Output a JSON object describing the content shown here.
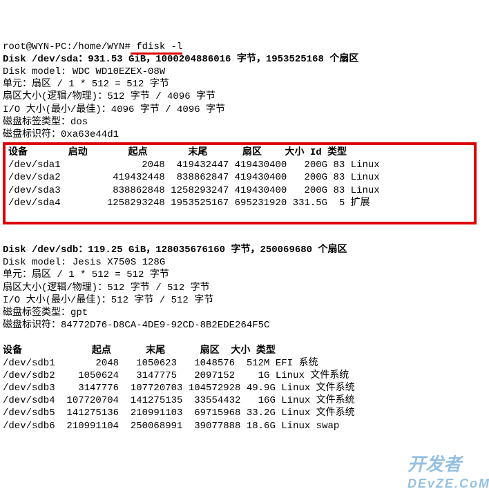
{
  "prompt": "root@WYN-PC:/home/WYN#",
  "command": " fdisk -l",
  "sda": {
    "header": "Disk /dev/sda：931.53 GiB，1000204886016 字节，1953525168 个扇区",
    "model": "Disk model: WDC WD10EZEX-08W",
    "unit": "单元：扇区 / 1 * 512 = 512 字节",
    "sector": "扇区大小(逻辑/物理)：512 字节 / 4096 字节",
    "io": "I/O 大小(最小/最佳)：4096 字节 / 4096 字节",
    "labeltype": "磁盘标签类型：dos",
    "ident": "磁盘标识符：0xa63e44d1",
    "tbl_header": "设备       启动       起点       末尾      扇区    大小 Id 类型",
    "parts": [
      "/dev/sda1              2048  419432447 419430400   200G 83 Linux",
      "/dev/sda2         419432448  838862847 419430400   200G 83 Linux",
      "/dev/sda3         838862848 1258293247 419430400   200G 83 Linux",
      "/dev/sda4        1258293248 1953525167 695231920 331.5G  5 扩展"
    ]
  },
  "sdb": {
    "header": "Disk /dev/sdb：119.25 GiB，128035676160 字节，250069680 个扇区",
    "model": "Disk model: Jesis X750S 128G",
    "unit": "单元：扇区 / 1 * 512 = 512 字节",
    "sector": "扇区大小(逻辑/物理)：512 字节 / 512 字节",
    "io": "I/O 大小(最小/最佳)：512 字节 / 512 字节",
    "labeltype": "磁盘标签类型：gpt",
    "ident": "磁盘标识符：84772D76-D8CA-4DE9-92CD-8B2EDE264F5C",
    "tbl_header": "设备            起点      末尾      扇区  大小 类型",
    "parts": [
      "/dev/sdb1       2048   1050623   1048576  512M EFI 系统",
      "/dev/sdb2    1050624   3147775   2097152    1G Linux 文件系统",
      "/dev/sdb3    3147776  107720703 104572928 49.9G Linux 文件系统",
      "/dev/sdb4  107720704  141275135  33554432   16G Linux 文件系统",
      "/dev/sdb5  141275136  210991103  69715968 33.2G Linux 文件系统",
      "/dev/sdb6  210991104  250068991  39077888 18.6G Linux swap"
    ]
  },
  "watermark_top": "开发者",
  "watermark_bottom": "DEvZE.CoM"
}
